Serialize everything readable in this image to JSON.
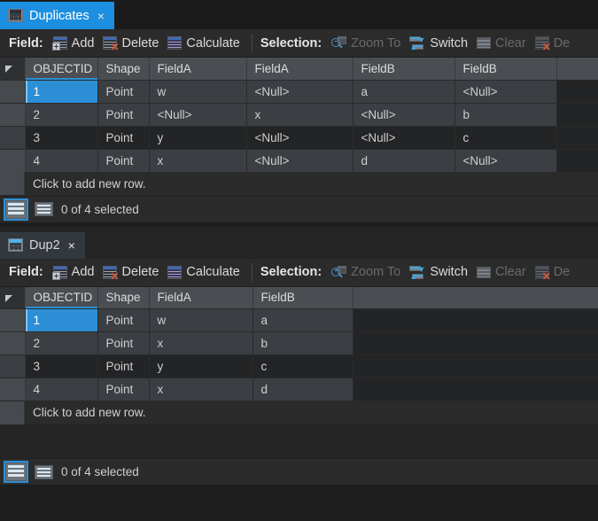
{
  "panels": [
    {
      "tab": {
        "label": "Duplicates",
        "close_label": "×",
        "active": true,
        "icon": "table-grid-icon"
      },
      "toolbar": {
        "field_label": "Field:",
        "add_label": "Add",
        "delete_label": "Delete",
        "calculate_label": "Calculate",
        "selection_label": "Selection:",
        "zoom_to_label": "Zoom To",
        "switch_label": "Switch",
        "clear_label": "Clear",
        "delete_sel_label": "De"
      },
      "table": {
        "columns": [
          "OBJECTID",
          "Shape",
          "FieldA",
          "FieldA",
          "FieldB",
          "FieldB"
        ],
        "rows": [
          [
            "1",
            "Point",
            "w",
            "<Null>",
            "a",
            "<Null>"
          ],
          [
            "2",
            "Point",
            "<Null>",
            "x",
            "<Null>",
            "b"
          ],
          [
            "3",
            "Point",
            "y",
            "<Null>",
            "<Null>",
            "c"
          ],
          [
            "4",
            "Point",
            "x",
            "<Null>",
            "d",
            "<Null>"
          ]
        ],
        "add_row_text": "Click to add new row."
      },
      "status": {
        "selection_text": "0 of 4 selected"
      }
    },
    {
      "tab": {
        "label": "Dup2",
        "close_label": "×",
        "active": false,
        "icon": "table-grid-icon"
      },
      "toolbar": {
        "field_label": "Field:",
        "add_label": "Add",
        "delete_label": "Delete",
        "calculate_label": "Calculate",
        "selection_label": "Selection:",
        "zoom_to_label": "Zoom To",
        "switch_label": "Switch",
        "clear_label": "Clear",
        "delete_sel_label": "De"
      },
      "table": {
        "columns": [
          "OBJECTID",
          "Shape",
          "FieldA",
          "FieldB"
        ],
        "rows": [
          [
            "1",
            "Point",
            "w",
            "a"
          ],
          [
            "2",
            "Point",
            "x",
            "b"
          ],
          [
            "3",
            "Point",
            "y",
            "c"
          ],
          [
            "4",
            "Point",
            "x",
            "d"
          ]
        ],
        "add_row_text": "Click to add new row."
      },
      "status": {
        "selection_text": "0 of 4 selected"
      }
    }
  ],
  "colors": {
    "accent": "#2c8fd6",
    "tab_active_bg": "#1d8fe0",
    "header_bg": "#4a4d52",
    "row_even": "#3b3e43",
    "row_odd": "#232426",
    "toolbar_bg": "#2b2b2b",
    "page_bg": "#1e1e1e"
  }
}
